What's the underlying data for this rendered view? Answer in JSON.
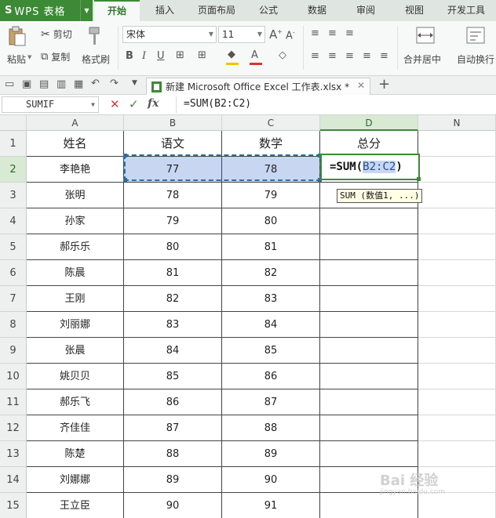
{
  "app": {
    "logo": "S",
    "title": "WPS 表格"
  },
  "menu_tabs": [
    "开始",
    "插入",
    "页面布局",
    "公式",
    "数据",
    "审阅",
    "视图",
    "开发工具"
  ],
  "ribbon": {
    "paste": "粘贴",
    "cut": "剪切",
    "copy": "复制",
    "format_painter": "格式刷",
    "font_name": "宋体",
    "font_size": "11",
    "merge_center": "合并居中",
    "wrap_text": "自动换行"
  },
  "document_tab": {
    "name": "新建 Microsoft Office Excel 工作表.xlsx *"
  },
  "formula_bar": {
    "name_box": "SUMIF",
    "formula": "=SUM(B2:C2)",
    "cancel_icon": "close-icon",
    "enter_icon": "check-icon",
    "function_icon": "fx"
  },
  "columns": [
    "A",
    "B",
    "C",
    "D",
    "N"
  ],
  "selected_column": "D",
  "selected_row": 2,
  "rows": [
    {
      "num": "1",
      "cells": [
        "姓名",
        "语文",
        "数学",
        "总分"
      ]
    },
    {
      "num": "2",
      "cells": [
        "李艳艳",
        "77",
        "78",
        ""
      ]
    },
    {
      "num": "3",
      "cells": [
        "张明",
        "78",
        "79",
        ""
      ]
    },
    {
      "num": "4",
      "cells": [
        "孙家",
        "79",
        "80",
        ""
      ]
    },
    {
      "num": "5",
      "cells": [
        "郝乐乐",
        "80",
        "81",
        ""
      ]
    },
    {
      "num": "6",
      "cells": [
        "陈晨",
        "81",
        "82",
        ""
      ]
    },
    {
      "num": "7",
      "cells": [
        "王刚",
        "82",
        "83",
        ""
      ]
    },
    {
      "num": "8",
      "cells": [
        "刘丽娜",
        "83",
        "84",
        ""
      ]
    },
    {
      "num": "9",
      "cells": [
        "张晨",
        "84",
        "85",
        ""
      ]
    },
    {
      "num": "10",
      "cells": [
        "姚贝贝",
        "85",
        "86",
        ""
      ]
    },
    {
      "num": "11",
      "cells": [
        "郝乐飞",
        "86",
        "87",
        ""
      ]
    },
    {
      "num": "12",
      "cells": [
        "齐佳佳",
        "87",
        "88",
        ""
      ]
    },
    {
      "num": "13",
      "cells": [
        "陈楚",
        "88",
        "89",
        ""
      ]
    },
    {
      "num": "14",
      "cells": [
        "刘娜娜",
        "89",
        "90",
        ""
      ]
    },
    {
      "num": "15",
      "cells": [
        "王立臣",
        "90",
        "91",
        ""
      ]
    }
  ],
  "editing_cell": {
    "prefix": "=SUM(",
    "ref": "B2:C2",
    "suffix": ")"
  },
  "tooltip": "SUM (数值1, ...)",
  "watermark": {
    "main": "Bai 经验",
    "sub": "jingyan.baidu.com"
  },
  "colors": {
    "accent": "#3c8a35",
    "selection": "#c8d6f2",
    "marquee": "#2f6fa8"
  }
}
